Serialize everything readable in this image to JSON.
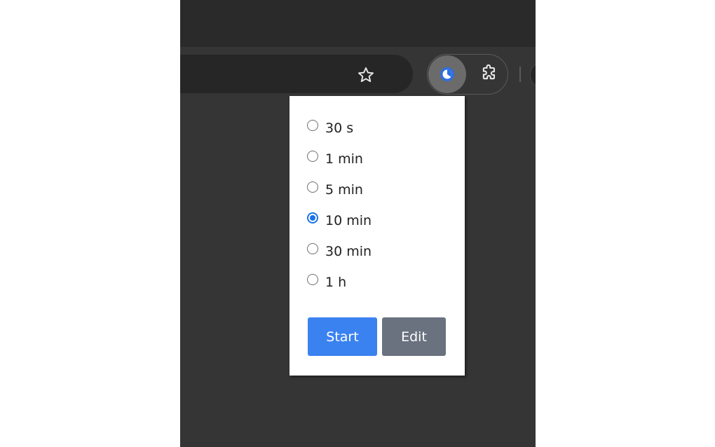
{
  "toolbar": {
    "bookmark_icon": "star-icon",
    "extension_icon": "timer-icon",
    "extensions_menu_icon": "puzzle-icon"
  },
  "popup": {
    "options": [
      {
        "label": "30 s",
        "checked": false
      },
      {
        "label": "1 min",
        "checked": false
      },
      {
        "label": "5 min",
        "checked": false
      },
      {
        "label": "10 min",
        "checked": true
      },
      {
        "label": "30 min",
        "checked": false
      },
      {
        "label": "1 h",
        "checked": false
      }
    ],
    "start_label": "Start",
    "edit_label": "Edit"
  },
  "colors": {
    "accent": "#3b82f1",
    "radio_checked": "#1a73e8",
    "edit_button": "#6a7280",
    "browser_bg": "#353535",
    "titlebar_bg": "#2a2a2a"
  }
}
